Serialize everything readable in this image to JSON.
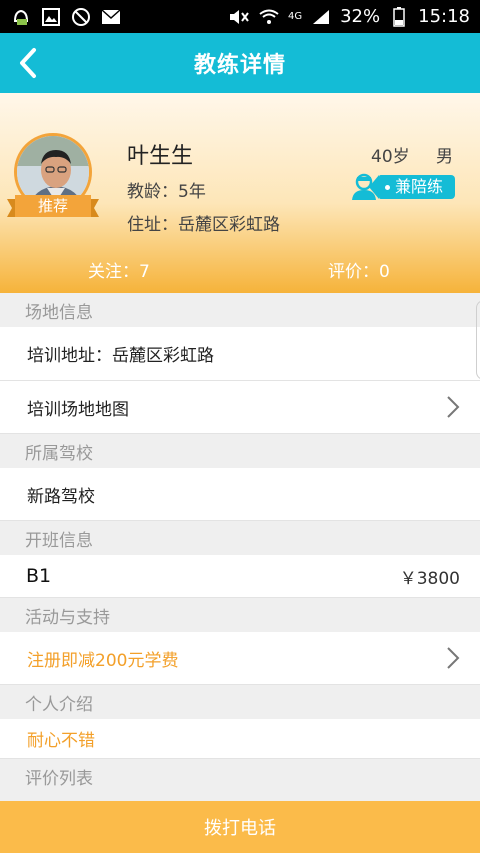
{
  "statusbar": {
    "network": "4G",
    "battery": "32%",
    "time": "15:18",
    "icons": [
      "notification-icon",
      "gallery-icon",
      "blocked-icon",
      "mail-icon",
      "mute-icon",
      "wifi-icon",
      "signal-icon",
      "battery-icon"
    ]
  },
  "header": {
    "title": "教练详情",
    "back_icon": "chevron-left-icon"
  },
  "profile": {
    "name": "叶生生",
    "age": "40岁",
    "gender": "男",
    "teach_years": "教龄：5年",
    "address": "住址：岳麓区彩虹路",
    "badge": "推荐",
    "tag": "兼陪练",
    "follow": "关注：7",
    "rating": "评价：0"
  },
  "sections": {
    "venue": {
      "title": "场地信息",
      "training_address": "培训地址：岳麓区彩虹路",
      "map_label": "培训场地地图"
    },
    "school": {
      "title": "所属驾校",
      "name": "新路驾校"
    },
    "classes": {
      "title": "开班信息",
      "license": "B1",
      "price": "￥3800"
    },
    "promo": {
      "title": "活动与支持",
      "text": "注册即减200元学费"
    },
    "intro": {
      "title": "个人介绍",
      "text": "耐心不错"
    },
    "reviews": {
      "title": "评价列表"
    }
  },
  "actions": {
    "call": "拨打电话"
  },
  "colors": {
    "accent": "#14bcd6",
    "orange": "#f3a02a",
    "button": "#fbbb4a"
  }
}
